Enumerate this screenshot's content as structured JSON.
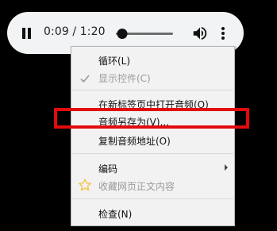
{
  "player": {
    "current_time": "0:09",
    "time_separator": " / ",
    "duration": "1:20",
    "progress_fraction": 0.1125,
    "play_state_icon": "pause-icon",
    "volume_icon": "volume-icon",
    "more_icon": "more-vertical-icon"
  },
  "context_menu": {
    "items": [
      {
        "label": "循环(L)",
        "enabled": true
      },
      {
        "label": "显示控件(C)",
        "enabled": false,
        "checked": true
      },
      {
        "label": "在新标签页中打开音频(O)",
        "enabled": true
      },
      {
        "label": "音频另存为(V)...",
        "enabled": true,
        "highlighted": true
      },
      {
        "label": "复制音频地址(O)",
        "enabled": true
      },
      {
        "label": "编码",
        "enabled": true,
        "has_submenu": true
      },
      {
        "label": "收藏网页正文内容",
        "enabled": false,
        "icon": "star-icon"
      },
      {
        "label": "检查(N)",
        "enabled": true
      }
    ]
  },
  "colors": {
    "page_background": "#000000",
    "player_background": "#f1f3f4",
    "menu_background": "#f2f2f2",
    "highlight_border": "#e20b0b",
    "disabled_text": "#9a9a9a",
    "star": "#f5c242"
  }
}
